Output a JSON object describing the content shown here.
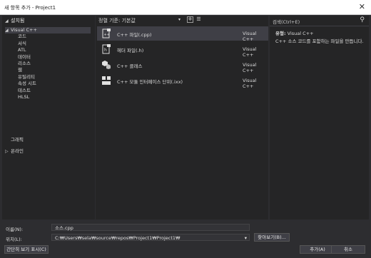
{
  "window": {
    "title": "새 항목 추가 - Project1",
    "close_icon": "✕"
  },
  "left_pane": {
    "header": "설치됨",
    "tree": [
      {
        "label": "Visual C++",
        "depth": 0,
        "caret": "◢",
        "selected": true
      },
      {
        "label": "코드",
        "depth": 1
      },
      {
        "label": "서식",
        "depth": 1
      },
      {
        "label": "ATL",
        "depth": 1
      },
      {
        "label": "데이터",
        "depth": 1
      },
      {
        "label": "리소스",
        "depth": 1
      },
      {
        "label": "웹",
        "depth": 1
      },
      {
        "label": "유틸리티",
        "depth": 1
      },
      {
        "label": "속성 시트",
        "depth": 1
      },
      {
        "label": "테스트",
        "depth": 1
      },
      {
        "label": "HLSL",
        "depth": 1
      },
      {
        "label": "그래픽",
        "depth": 0,
        "caret": ""
      },
      {
        "label": "온라인",
        "depth": 0,
        "caret": "▷"
      }
    ]
  },
  "toolbar": {
    "sort_label": "정렬 기준:  기본값",
    "sort_arrow": "▾",
    "grid_icon": "⁜",
    "list_icon": "☰"
  },
  "templates": [
    {
      "name": "C++ 파일(.cpp)",
      "lang": "Visual C++",
      "icon": "cpp-file-icon",
      "selected": true
    },
    {
      "name": "헤더 파일(.h)",
      "lang": "Visual C++",
      "icon": "header-file-icon"
    },
    {
      "name": "C++ 클래스",
      "lang": "Visual C++",
      "icon": "class-icon"
    },
    {
      "name": "C++ 모듈 인터페이스 단위(.ixx)",
      "lang": "Visual C++",
      "icon": "module-icon"
    }
  ],
  "right_pane": {
    "search_placeholder": "검색(Ctrl+E)",
    "search_icon": "⚲",
    "type_label": "유형:",
    "type_value": "Visual C++",
    "description": "C++ 소스 코드를 포함하는 파일을 만듭니다."
  },
  "form": {
    "name_label": "이름(N):",
    "name_value": "소스.cpp",
    "location_label": "위치(L):",
    "location_value": "C:₩Users₩sela₩source₩repos₩Project1₩Project1₩",
    "dropdown_arrow": "▾",
    "browse_label": "찾아보기(B)..."
  },
  "footer": {
    "compact_label": "간단히 보기 표시(C)",
    "add_label": "추가(A)",
    "cancel_label": "취소"
  }
}
